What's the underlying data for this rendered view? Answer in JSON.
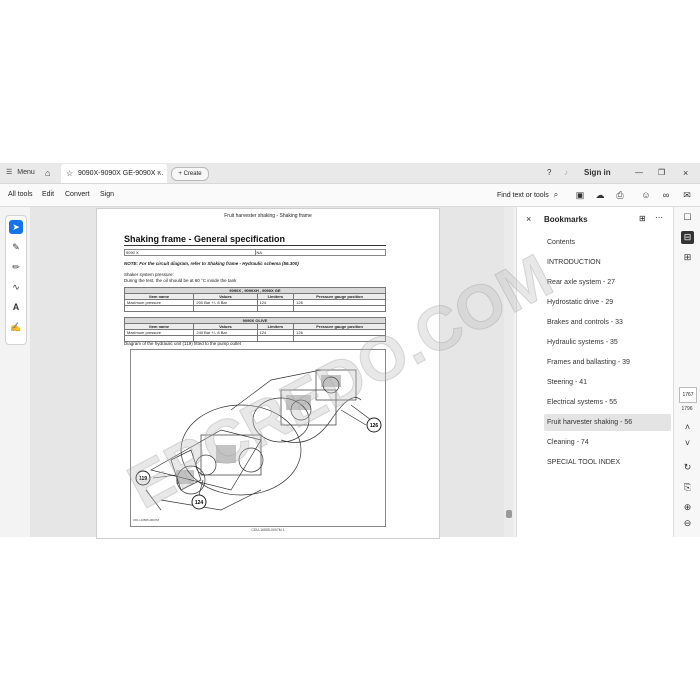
{
  "tabbar": {
    "menu_label": "Menu",
    "doc_tab_title": "9090X-9090X GE-9090X ...",
    "create_label": "Create",
    "signin_label": "Sign in"
  },
  "menubar": {
    "items": [
      "All tools",
      "Edit",
      "Convert",
      "Sign"
    ],
    "find_label": "Find text or tools"
  },
  "page": {
    "header": "Fruit harvester shaking - Shaking frame",
    "title": "Shaking frame - General specification",
    "top_table": [
      "9090 X",
      "NA"
    ],
    "note": "NOTE: For the circuit diagram, refer to Shaking frame - Hydraulic schema (56.300)",
    "pressure_label": "Shaker system pressure:",
    "pressure_text": "During the test, the oil should be at 60 °C inside the tank",
    "table1": {
      "header": "9090X , 9090XH , 9090X GE",
      "columns": [
        "Item name",
        "Values",
        "Limiters",
        "Pressure gauge position"
      ],
      "row": [
        "Maximum pressure",
        "200 Bar +/- 8 Bar",
        "124",
        "126"
      ]
    },
    "table2": {
      "header": "9090X OLIVE",
      "columns": [
        "Item name",
        "Values",
        "Limiters",
        "Pressure gauge position"
      ],
      "row": [
        "Maximum pressure",
        "240 Bar +/- 8 Bar",
        "124",
        "126"
      ]
    },
    "diagram_caption": "Diagram of the hydraulic unit (119) fitted to the pump outlet",
    "callouts": [
      "119",
      "124",
      "126"
    ],
    "figure_id": "CDU-16505-0007M",
    "footer": "CDU-16505-0007M 1"
  },
  "bookmarks": {
    "title": "Bookmarks",
    "items": [
      "Contents",
      "INTRODUCTION",
      "Rear axle system - 27",
      "Hydrostatic drive - 29",
      "Brakes and controls - 33",
      "Hydraulic systems - 35",
      "Frames and ballasting - 39",
      "Steering - 41",
      "Electrical systems - 55",
      "Fruit harvester shaking - 56",
      "Cleaning - 74",
      "SPECIAL TOOL INDEX"
    ],
    "selected_index": 9
  },
  "rightrail": {
    "current_page": "1767",
    "total_pages": "1796"
  },
  "watermark": "EPCREDO.COM",
  "colors": {
    "accent": "#1473e6",
    "selected_bg": "#e4e4e4"
  }
}
